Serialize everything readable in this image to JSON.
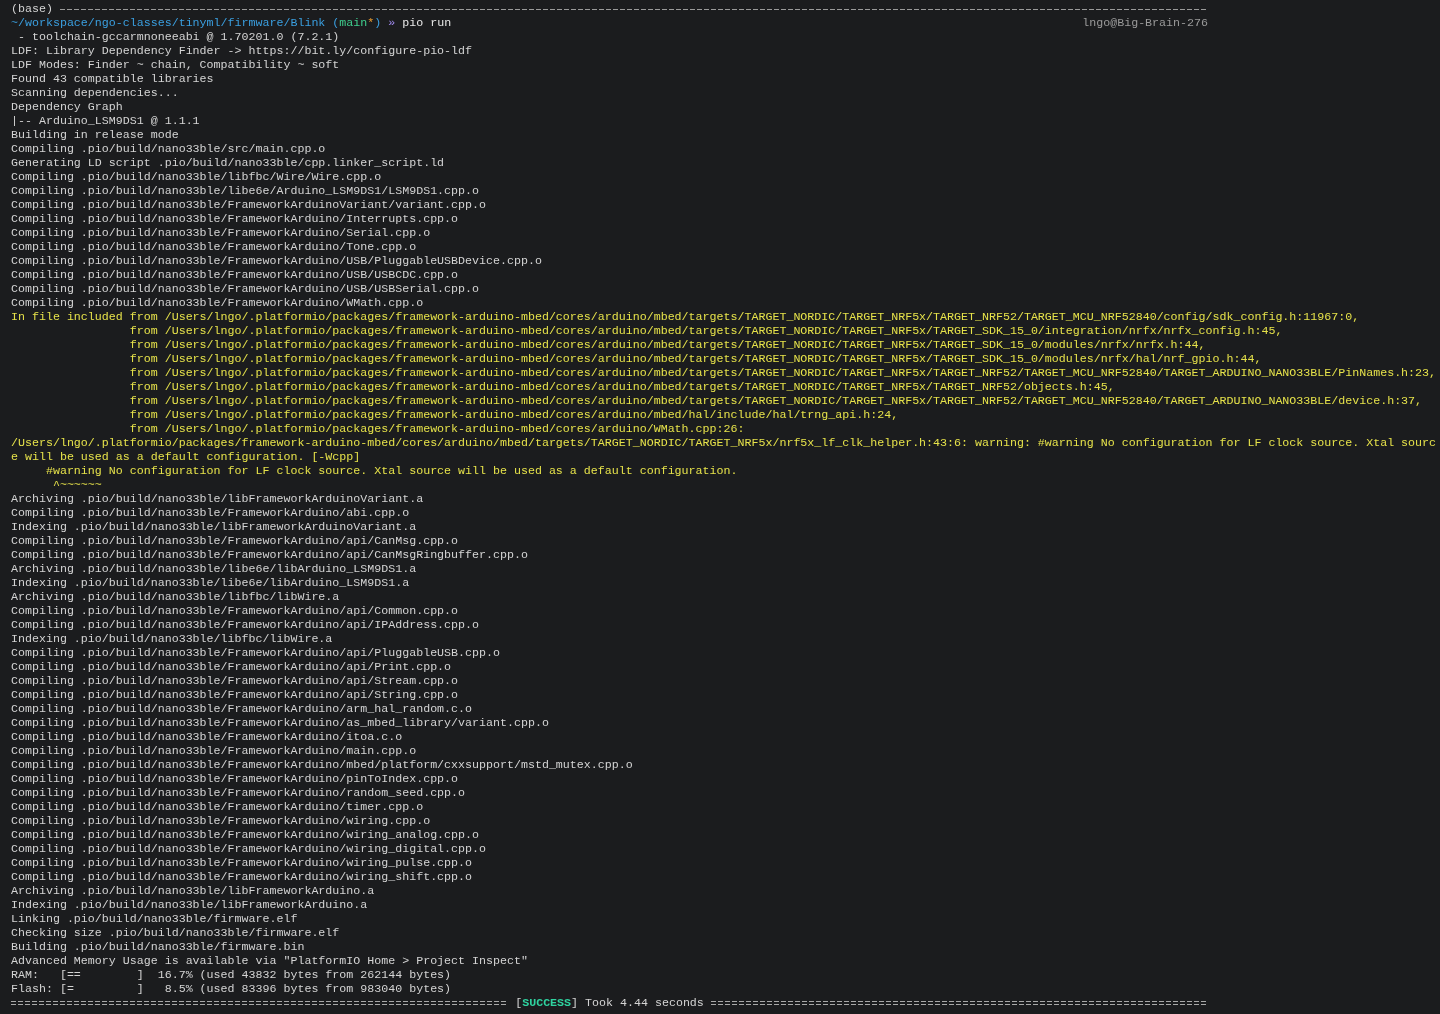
{
  "header": {
    "label": "(base)"
  },
  "prompt": {
    "segments": [
      {
        "kind": "path",
        "text": "~/workspace/ngo-classes/tinyml/firmware/Blink"
      },
      {
        "kind": "open",
        "text": "("
      },
      {
        "kind": "branch",
        "text": "main"
      },
      {
        "kind": "dirty",
        "text": "*"
      },
      {
        "kind": "close",
        "text": ")"
      },
      {
        "kind": "arrow",
        "text": "»"
      },
      {
        "kind": "command",
        "text": "pio run"
      }
    ],
    "host": "lngo@Big-Brain-276"
  },
  "lines": [
    {
      "kind": "plain",
      "text": " - toolchain-gccarmnoneeabi @ 1.70201.0 (7.2.1)"
    },
    {
      "kind": "plain",
      "text": "LDF: Library Dependency Finder -> https://bit.ly/configure-pio-ldf"
    },
    {
      "kind": "plain",
      "text": "LDF Modes: Finder ~ chain, Compatibility ~ soft"
    },
    {
      "kind": "plain",
      "text": "Found 43 compatible libraries"
    },
    {
      "kind": "plain",
      "text": "Scanning dependencies..."
    },
    {
      "kind": "plain",
      "text": "Dependency Graph"
    },
    {
      "kind": "plain",
      "text": "|-- Arduino_LSM9DS1 @ 1.1.1"
    },
    {
      "kind": "plain",
      "text": "Building in release mode"
    },
    {
      "kind": "plain",
      "text": "Compiling .pio/build/nano33ble/src/main.cpp.o"
    },
    {
      "kind": "plain",
      "text": "Generating LD script .pio/build/nano33ble/cpp.linker_script.ld"
    },
    {
      "kind": "plain",
      "text": "Compiling .pio/build/nano33ble/libfbc/Wire/Wire.cpp.o"
    },
    {
      "kind": "plain",
      "text": "Compiling .pio/build/nano33ble/libe6e/Arduino_LSM9DS1/LSM9DS1.cpp.o"
    },
    {
      "kind": "plain",
      "text": "Compiling .pio/build/nano33ble/FrameworkArduinoVariant/variant.cpp.o"
    },
    {
      "kind": "plain",
      "text": "Compiling .pio/build/nano33ble/FrameworkArduino/Interrupts.cpp.o"
    },
    {
      "kind": "plain",
      "text": "Compiling .pio/build/nano33ble/FrameworkArduino/Serial.cpp.o"
    },
    {
      "kind": "plain",
      "text": "Compiling .pio/build/nano33ble/FrameworkArduino/Tone.cpp.o"
    },
    {
      "kind": "plain",
      "text": "Compiling .pio/build/nano33ble/FrameworkArduino/USB/PluggableUSBDevice.cpp.o"
    },
    {
      "kind": "plain",
      "text": "Compiling .pio/build/nano33ble/FrameworkArduino/USB/USBCDC.cpp.o"
    },
    {
      "kind": "plain",
      "text": "Compiling .pio/build/nano33ble/FrameworkArduino/USB/USBSerial.cpp.o"
    },
    {
      "kind": "plain",
      "text": "Compiling .pio/build/nano33ble/FrameworkArduino/WMath.cpp.o"
    },
    {
      "kind": "warning",
      "text": "In file included from /Users/lngo/.platformio/packages/framework-arduino-mbed/cores/arduino/mbed/targets/TARGET_NORDIC/TARGET_NRF5x/TARGET_NRF52/TARGET_MCU_NRF52840/config/sdk_config.h:11967:0,"
    },
    {
      "kind": "warning",
      "text": "                 from /Users/lngo/.platformio/packages/framework-arduino-mbed/cores/arduino/mbed/targets/TARGET_NORDIC/TARGET_NRF5x/TARGET_SDK_15_0/integration/nrfx/nrfx_config.h:45,"
    },
    {
      "kind": "warning",
      "text": "                 from /Users/lngo/.platformio/packages/framework-arduino-mbed/cores/arduino/mbed/targets/TARGET_NORDIC/TARGET_NRF5x/TARGET_SDK_15_0/modules/nrfx/nrfx.h:44,"
    },
    {
      "kind": "warning",
      "text": "                 from /Users/lngo/.platformio/packages/framework-arduino-mbed/cores/arduino/mbed/targets/TARGET_NORDIC/TARGET_NRF5x/TARGET_SDK_15_0/modules/nrfx/hal/nrf_gpio.h:44,"
    },
    {
      "kind": "warning",
      "text": "                 from /Users/lngo/.platformio/packages/framework-arduino-mbed/cores/arduino/mbed/targets/TARGET_NORDIC/TARGET_NRF5x/TARGET_NRF52/TARGET_MCU_NRF52840/TARGET_ARDUINO_NANO33BLE/PinNames.h:23,"
    },
    {
      "kind": "warning",
      "text": "                 from /Users/lngo/.platformio/packages/framework-arduino-mbed/cores/arduino/mbed/targets/TARGET_NORDIC/TARGET_NRF5x/TARGET_NRF52/objects.h:45,"
    },
    {
      "kind": "warning",
      "text": "                 from /Users/lngo/.platformio/packages/framework-arduino-mbed/cores/arduino/mbed/targets/TARGET_NORDIC/TARGET_NRF5x/TARGET_NRF52/TARGET_MCU_NRF52840/TARGET_ARDUINO_NANO33BLE/device.h:37,"
    },
    {
      "kind": "warning",
      "text": "                 from /Users/lngo/.platformio/packages/framework-arduino-mbed/cores/arduino/mbed/hal/include/hal/trng_api.h:24,"
    },
    {
      "kind": "warning",
      "text": "                 from /Users/lngo/.platformio/packages/framework-arduino-mbed/cores/arduino/WMath.cpp:26:"
    },
    {
      "kind": "warning",
      "text": "/Users/lngo/.platformio/packages/framework-arduino-mbed/cores/arduino/mbed/targets/TARGET_NORDIC/TARGET_NRF5x/nrf5x_lf_clk_helper.h:43:6: warning: #warning No configuration for LF clock source. Xtal sourc"
    },
    {
      "kind": "warning",
      "text": "e will be used as a default configuration. [-Wcpp]"
    },
    {
      "kind": "warning",
      "text": "     #warning No configuration for LF clock source. Xtal source will be used as a default configuration."
    },
    {
      "kind": "warning",
      "text": "      ^~~~~~~"
    },
    {
      "kind": "plain",
      "text": "Archiving .pio/build/nano33ble/libFrameworkArduinoVariant.a"
    },
    {
      "kind": "plain",
      "text": "Compiling .pio/build/nano33ble/FrameworkArduino/abi.cpp.o"
    },
    {
      "kind": "plain",
      "text": "Indexing .pio/build/nano33ble/libFrameworkArduinoVariant.a"
    },
    {
      "kind": "plain",
      "text": "Compiling .pio/build/nano33ble/FrameworkArduino/api/CanMsg.cpp.o"
    },
    {
      "kind": "plain",
      "text": "Compiling .pio/build/nano33ble/FrameworkArduino/api/CanMsgRingbuffer.cpp.o"
    },
    {
      "kind": "plain",
      "text": "Archiving .pio/build/nano33ble/libe6e/libArduino_LSM9DS1.a"
    },
    {
      "kind": "plain",
      "text": "Indexing .pio/build/nano33ble/libe6e/libArduino_LSM9DS1.a"
    },
    {
      "kind": "plain",
      "text": "Archiving .pio/build/nano33ble/libfbc/libWire.a"
    },
    {
      "kind": "plain",
      "text": "Compiling .pio/build/nano33ble/FrameworkArduino/api/Common.cpp.o"
    },
    {
      "kind": "plain",
      "text": "Compiling .pio/build/nano33ble/FrameworkArduino/api/IPAddress.cpp.o"
    },
    {
      "kind": "plain",
      "text": "Indexing .pio/build/nano33ble/libfbc/libWire.a"
    },
    {
      "kind": "plain",
      "text": "Compiling .pio/build/nano33ble/FrameworkArduino/api/PluggableUSB.cpp.o"
    },
    {
      "kind": "plain",
      "text": "Compiling .pio/build/nano33ble/FrameworkArduino/api/Print.cpp.o"
    },
    {
      "kind": "plain",
      "text": "Compiling .pio/build/nano33ble/FrameworkArduino/api/Stream.cpp.o"
    },
    {
      "kind": "plain",
      "text": "Compiling .pio/build/nano33ble/FrameworkArduino/api/String.cpp.o"
    },
    {
      "kind": "plain",
      "text": "Compiling .pio/build/nano33ble/FrameworkArduino/arm_hal_random.c.o"
    },
    {
      "kind": "plain",
      "text": "Compiling .pio/build/nano33ble/FrameworkArduino/as_mbed_library/variant.cpp.o"
    },
    {
      "kind": "plain",
      "text": "Compiling .pio/build/nano33ble/FrameworkArduino/itoa.c.o"
    },
    {
      "kind": "plain",
      "text": "Compiling .pio/build/nano33ble/FrameworkArduino/main.cpp.o"
    },
    {
      "kind": "plain",
      "text": "Compiling .pio/build/nano33ble/FrameworkArduino/mbed/platform/cxxsupport/mstd_mutex.cpp.o"
    },
    {
      "kind": "plain",
      "text": "Compiling .pio/build/nano33ble/FrameworkArduino/pinToIndex.cpp.o"
    },
    {
      "kind": "plain",
      "text": "Compiling .pio/build/nano33ble/FrameworkArduino/random_seed.cpp.o"
    },
    {
      "kind": "plain",
      "text": "Compiling .pio/build/nano33ble/FrameworkArduino/timer.cpp.o"
    },
    {
      "kind": "plain",
      "text": "Compiling .pio/build/nano33ble/FrameworkArduino/wiring.cpp.o"
    },
    {
      "kind": "plain",
      "text": "Compiling .pio/build/nano33ble/FrameworkArduino/wiring_analog.cpp.o"
    },
    {
      "kind": "plain",
      "text": "Compiling .pio/build/nano33ble/FrameworkArduino/wiring_digital.cpp.o"
    },
    {
      "kind": "plain",
      "text": "Compiling .pio/build/nano33ble/FrameworkArduino/wiring_pulse.cpp.o"
    },
    {
      "kind": "plain",
      "text": "Compiling .pio/build/nano33ble/FrameworkArduino/wiring_shift.cpp.o"
    },
    {
      "kind": "plain",
      "text": "Archiving .pio/build/nano33ble/libFrameworkArduino.a"
    },
    {
      "kind": "plain",
      "text": "Indexing .pio/build/nano33ble/libFrameworkArduino.a"
    },
    {
      "kind": "plain",
      "text": "Linking .pio/build/nano33ble/firmware.elf"
    },
    {
      "kind": "plain",
      "text": "Checking size .pio/build/nano33ble/firmware.elf"
    },
    {
      "kind": "plain",
      "text": "Building .pio/build/nano33ble/firmware.bin"
    },
    {
      "kind": "plain",
      "text": "Advanced Memory Usage is available via \"PlatformIO Home > Project Inspect\""
    },
    {
      "kind": "plain",
      "text": "RAM:   [==        ]  16.7% (used 43832 bytes from 262144 bytes)"
    },
    {
      "kind": "plain",
      "text": "Flash: [=         ]   8.5% (used 83396 bytes from 983040 bytes)"
    }
  ],
  "summary": {
    "open": "[",
    "status": "SUCCESS",
    "close": "]",
    "message": "Took 4.44 seconds"
  }
}
